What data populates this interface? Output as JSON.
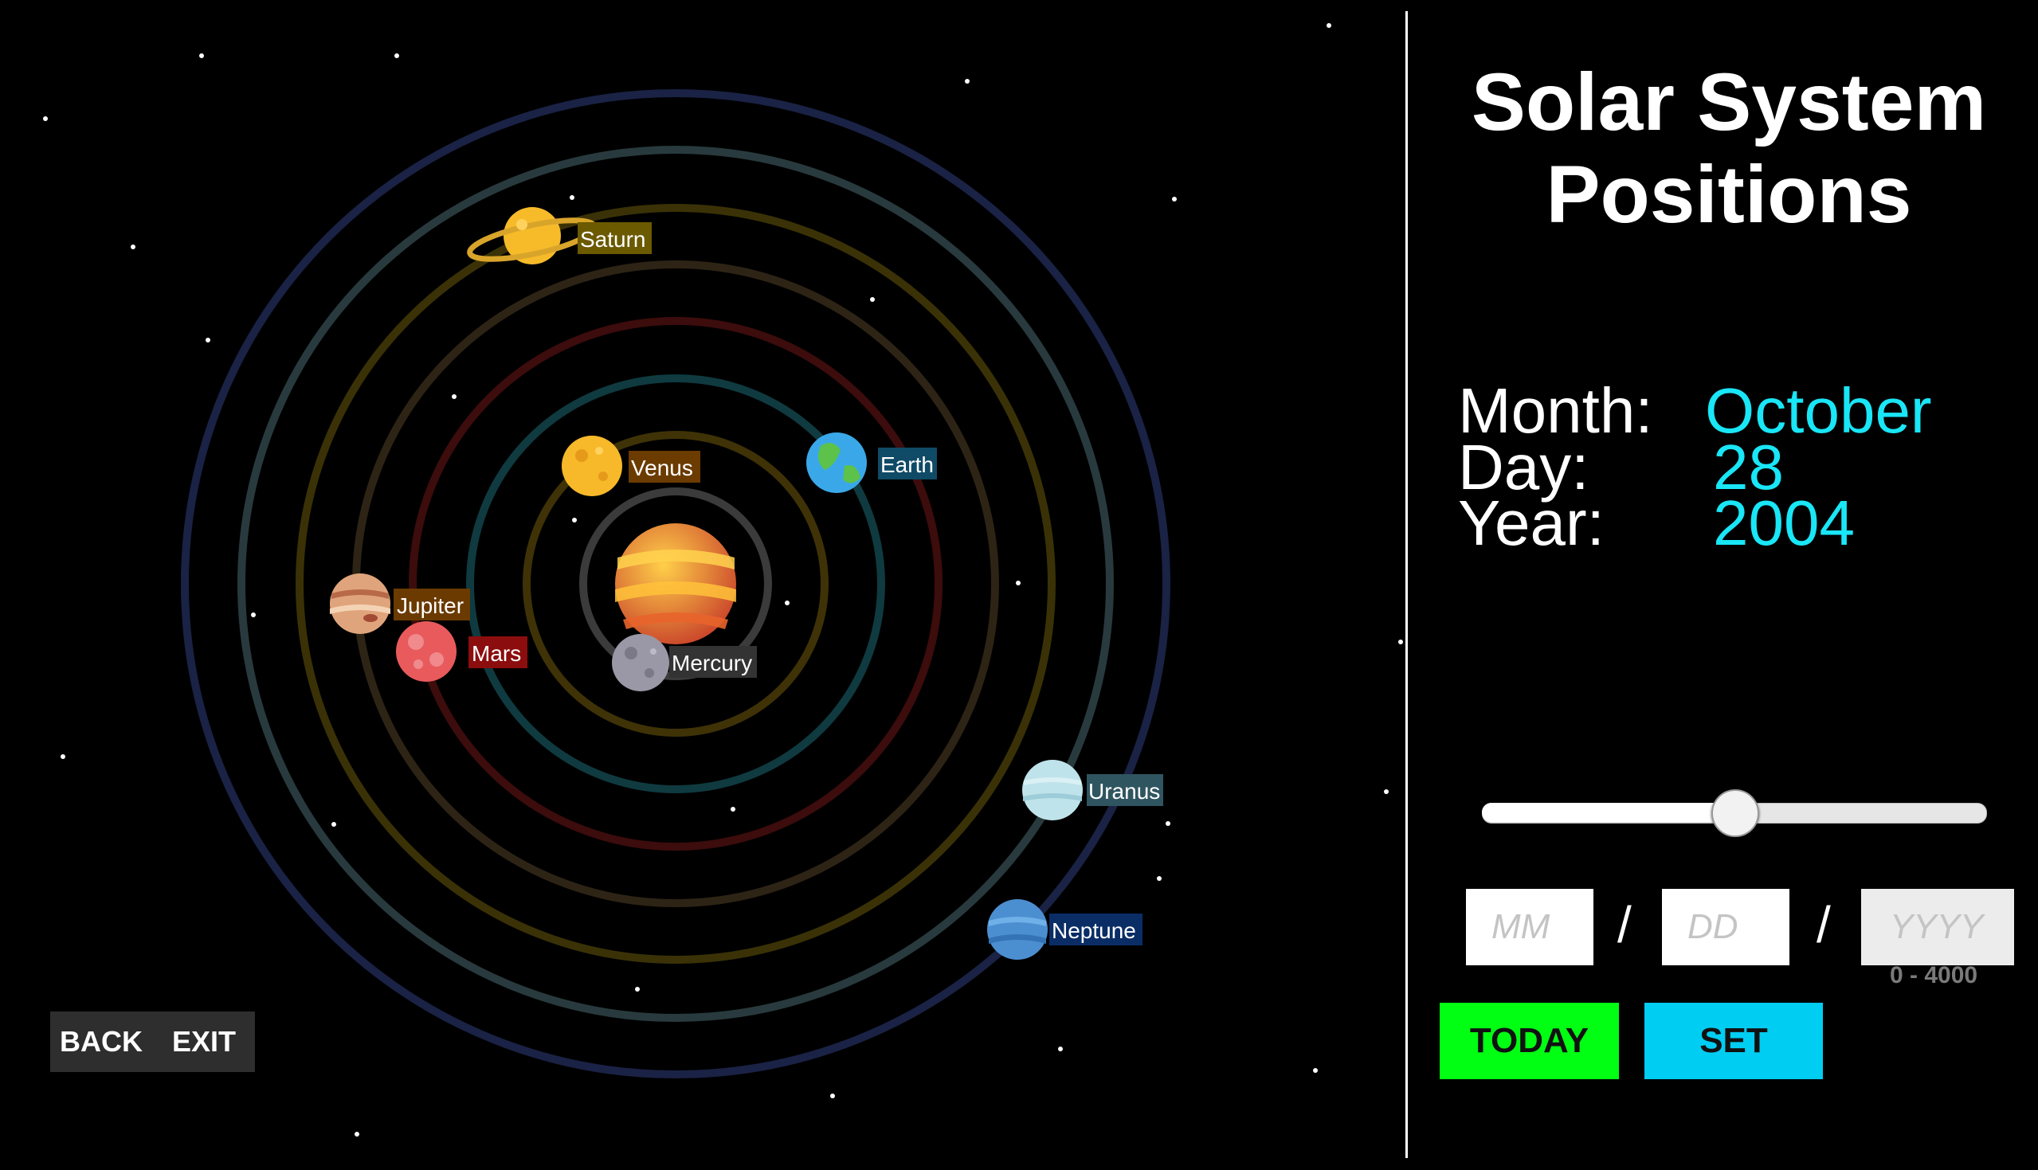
{
  "title": "Solar System Positions",
  "date": {
    "month_label": "Month:",
    "month_value": "October",
    "day_label": "Day:",
    "day_value": "28",
    "year_label": "Year:",
    "year_value": "2004"
  },
  "slider": {
    "level_fraction": 0.5
  },
  "inputs": {
    "month_placeholder": "MM",
    "day_placeholder": "DD",
    "year_placeholder": "YYYY",
    "separator": "/",
    "year_range_hint": "0 - 4000"
  },
  "buttons": {
    "today": "TODAY",
    "set": "SET"
  },
  "nav": {
    "back": "BACK",
    "exit": "EXIT"
  },
  "colors": {
    "accent_cyan": "#19e6f6",
    "today_green": "#00ff12",
    "set_blue": "#00cdf2"
  },
  "planets": [
    {
      "name": "Mercury",
      "label": "Mercury",
      "icon": "mercury-icon",
      "label_color": "#333333"
    },
    {
      "name": "Venus",
      "label": "Venus",
      "icon": "venus-icon",
      "label_color": "#6b3b00"
    },
    {
      "name": "Earth",
      "label": "Earth",
      "icon": "earth-icon",
      "label_color": "#0f4a66"
    },
    {
      "name": "Mars",
      "label": "Mars",
      "icon": "mars-icon",
      "label_color": "#8c0d0d"
    },
    {
      "name": "Jupiter",
      "label": "Jupiter",
      "icon": "jupiter-icon",
      "label_color": "#6b3a00"
    },
    {
      "name": "Saturn",
      "label": "Saturn",
      "icon": "saturn-icon",
      "label_color": "#6b5a00"
    },
    {
      "name": "Uranus",
      "label": "Uranus",
      "icon": "uranus-icon",
      "label_color": "#2f5560"
    },
    {
      "name": "Neptune",
      "label": "Neptune",
      "icon": "neptune-icon",
      "label_color": "#0a2d66"
    }
  ],
  "sun_icon": "sun-icon"
}
